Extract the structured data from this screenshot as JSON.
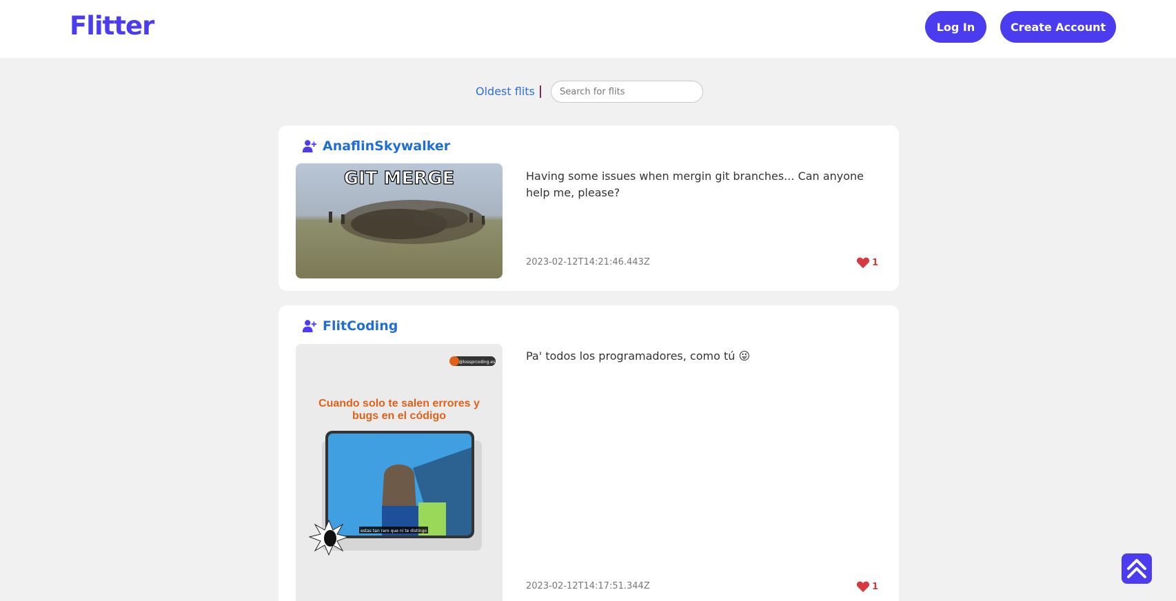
{
  "header": {
    "logo": "Flitter",
    "login_label": "Log In",
    "create_account_label": "Create Account"
  },
  "filters": {
    "sort_label": "Oldest flits",
    "search_placeholder": "Search for flits"
  },
  "flits": [
    {
      "username": "AnaflinSkywalker",
      "text": "Having some issues when mergin git branches... Can anyone help me, please?",
      "date": "2023-02-12T14:21:46.443Z",
      "likes": "1",
      "image": {
        "caption": "GIT MERGE"
      }
    },
    {
      "username": "FlitCoding",
      "text": "Pa' todos los programadores, como tú 😜",
      "date": "2023-02-12T14:17:51.344Z",
      "likes": "1",
      "image": {
        "handle": "@lossprcoding.es",
        "headline": "Cuando solo te salen errores y bugs en el código",
        "subtitle": "estas tan raro que ni te distingo"
      }
    }
  ],
  "colors": {
    "accent": "#4b3cf0",
    "link": "#1f6ed4",
    "heart": "#d8383f"
  },
  "icons": {
    "user": "user-plus-icon",
    "like": "heart-icon",
    "scroll_top": "double-chevron-up-icon"
  }
}
